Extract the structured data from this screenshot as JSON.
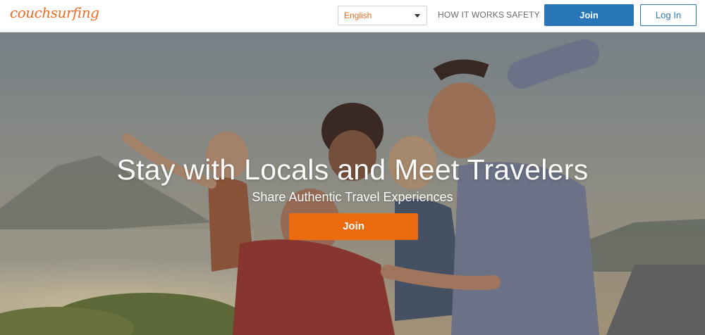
{
  "header": {
    "logo_text": "couchsurfing",
    "language_select": {
      "selected": "English"
    },
    "nav": {
      "how_it_works": "HOW IT WORKS",
      "safety": "SAFETY"
    },
    "join_label": "Join",
    "login_label": "Log In"
  },
  "hero": {
    "title": "Stay with Locals and Meet Travelers",
    "subtitle": "Share Authentic Travel Experiences",
    "cta_label": "Join",
    "background_image": "group-of-friends-photo"
  },
  "colors": {
    "brand_orange": "#ed6b0f",
    "primary_blue": "#2a77b8"
  }
}
